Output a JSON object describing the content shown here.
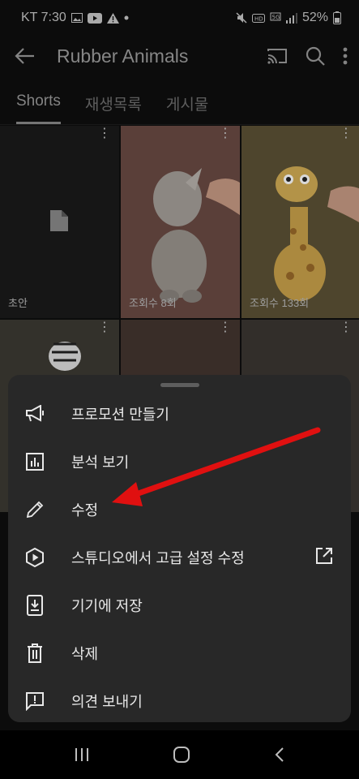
{
  "status_bar": {
    "carrier_time": "KT 7:30",
    "battery": "52%"
  },
  "app_bar": {
    "title": "Rubber Animals"
  },
  "tabs": [
    {
      "label": "Shorts",
      "active": true
    },
    {
      "label": "재생목록",
      "active": false
    },
    {
      "label": "게시물",
      "active": false
    }
  ],
  "grid": [
    {
      "label": "초안"
    },
    {
      "label": "조회수 8회"
    },
    {
      "label": "조회수 133회"
    }
  ],
  "menu": {
    "items": [
      {
        "label": "프로모션 만들기",
        "icon": "megaphone-icon"
      },
      {
        "label": "분석 보기",
        "icon": "analytics-icon"
      },
      {
        "label": "수정",
        "icon": "pencil-icon"
      },
      {
        "label": "스튜디오에서 고급 설정 수정",
        "icon": "studio-icon"
      },
      {
        "label": "기기에 저장",
        "icon": "download-icon"
      },
      {
        "label": "삭제",
        "icon": "trash-icon"
      },
      {
        "label": "의견 보내기",
        "icon": "feedback-icon"
      }
    ]
  },
  "colors": {
    "annotation_arrow": "#e01010",
    "sheet_bg": "#282828"
  }
}
